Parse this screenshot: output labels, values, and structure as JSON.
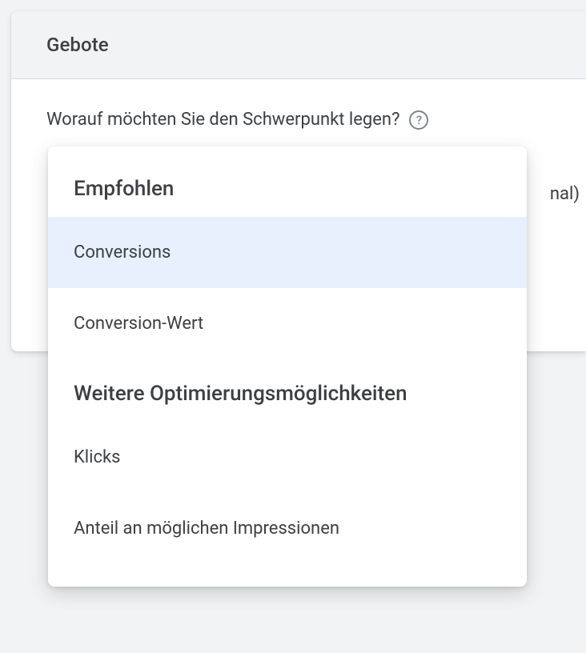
{
  "panel": {
    "title": "Gebote"
  },
  "question": {
    "text": "Worauf möchten Sie den Schwerpunkt legen?",
    "helpGlyph": "?"
  },
  "hiddenPartial": "nal)",
  "dropdown": {
    "sections": [
      {
        "header": "Empfohlen",
        "items": [
          {
            "label": "Conversions",
            "selected": true
          },
          {
            "label": "Conversion-Wert",
            "selected": false
          }
        ]
      },
      {
        "header": "Weitere Optimierungsmöglichkeiten",
        "items": [
          {
            "label": "Klicks",
            "selected": false
          },
          {
            "label": "Anteil an möglichen Impressionen",
            "selected": false
          }
        ]
      }
    ]
  }
}
